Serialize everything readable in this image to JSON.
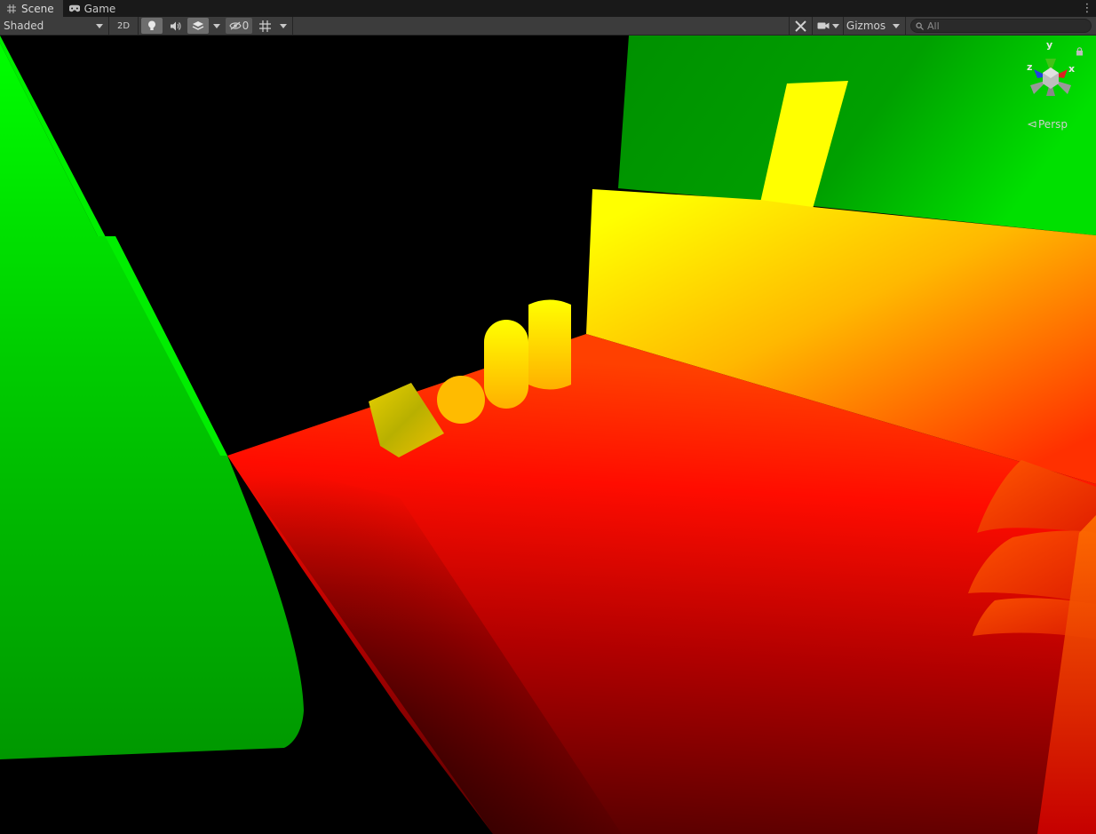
{
  "tabs": [
    {
      "label": "Scene",
      "icon": "grid-icon",
      "active": true
    },
    {
      "label": "Game",
      "icon": "gamepad-icon",
      "active": false
    }
  ],
  "toolbar": {
    "draw_mode": "Shaded",
    "mode_2d": "2D",
    "hidden_count": "0",
    "gizmos_label": "Gizmos",
    "search_placeholder": "All"
  },
  "gizmo": {
    "x_label": "x",
    "y_label": "y",
    "z_label": "z",
    "projection": "Persp"
  },
  "colors": {
    "toolbar_bg": "#3c3c3c",
    "tab_bg": "#191919",
    "x_axis": "#e02020",
    "y_axis": "#44c218",
    "z_axis": "#2040e0"
  }
}
